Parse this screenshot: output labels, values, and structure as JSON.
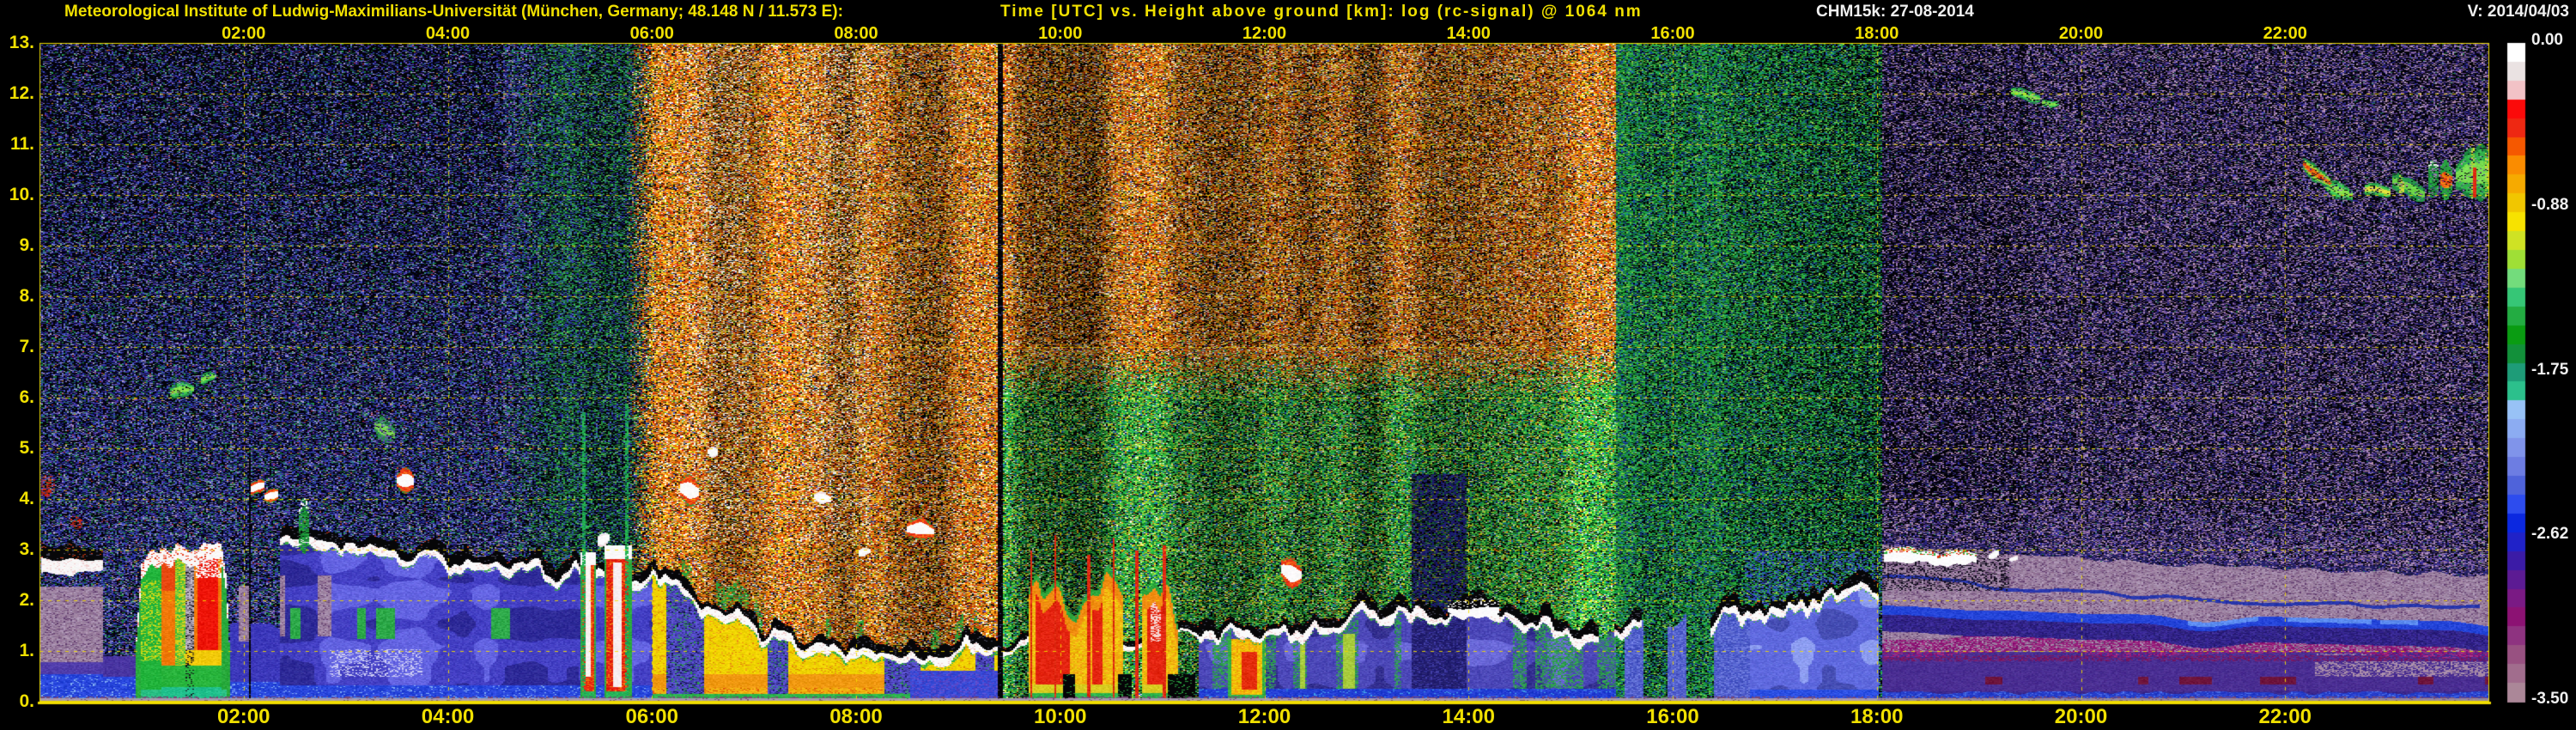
{
  "header": {
    "institute": "Meteorological Institute of Ludwig-Maximilians-Universität (München, Germany; 48.148 N / 11.573 E):",
    "plot_title": "Time [UTC] vs. Height above ground [km]: log (rc-signal) @ 1064 nm",
    "instrument_date": "CHM15k: 27-08-2014",
    "version": "V: 2014/04/03"
  },
  "chart_data": {
    "type": "heatmap",
    "title": "Time [UTC] vs. Height above ground [km]: log (rc-signal) @ 1064 nm",
    "xlabel": "Time [UTC]",
    "ylabel": "Height above ground [km]",
    "quantity": "log (rc-signal) @ 1064 nm",
    "instrument": "CHM15k",
    "date": "27-08-2014",
    "x_range_hours": [
      0,
      24
    ],
    "y_range_km": [
      0,
      13
    ],
    "grid": true,
    "time_ticks": [
      [
        "02:00",
        2
      ],
      [
        "04:00",
        4
      ],
      [
        "06:00",
        6
      ],
      [
        "08:00",
        8
      ],
      [
        "10:00",
        10
      ],
      [
        "12:00",
        12
      ],
      [
        "14:00",
        14
      ],
      [
        "16:00",
        16
      ],
      [
        "18:00",
        18
      ],
      [
        "20:00",
        20
      ],
      [
        "22:00",
        22
      ]
    ],
    "height_ticks": [
      [
        "0.",
        0
      ],
      [
        "1.",
        1
      ],
      [
        "2.",
        2
      ],
      [
        "3.",
        3
      ],
      [
        "4.",
        4
      ],
      [
        "5.",
        5
      ],
      [
        "6.",
        6
      ],
      [
        "7.",
        7
      ],
      [
        "8.",
        8
      ],
      [
        "9.",
        9
      ],
      [
        "10.",
        10
      ],
      [
        "11.",
        11
      ],
      [
        "12.",
        12
      ],
      [
        "13.",
        13
      ]
    ],
    "colorbar": {
      "labels": [
        [
          "0.00",
          0
        ],
        [
          "-0.88",
          -0.875
        ],
        [
          "-1.75",
          -1.75
        ],
        [
          "-2.62",
          -2.625
        ],
        [
          "-3.50",
          -3.5
        ]
      ],
      "colors": [
        "#ffffff",
        "#eae2e2",
        "#f2c2c6",
        "#fb0a0a",
        "#ee2812",
        "#f55800",
        "#fa8c00",
        "#f6aa00",
        "#f1c600",
        "#f7e200",
        "#cfe224",
        "#9fdf36",
        "#73dc7c",
        "#36c676",
        "#23ac42",
        "#0a9c12",
        "#12903a",
        "#1e9c78",
        "#2cc08c",
        "#98c2f6",
        "#8cacf2",
        "#8094ea",
        "#6d7de2",
        "#4f63da",
        "#2d4cee",
        "#0b28e0",
        "#2022c8",
        "#3b1ba6",
        "#5c1b93",
        "#7a1a84",
        "#8c1273",
        "#8e3380",
        "#985181",
        "#a16d8d",
        "#ab8798"
      ]
    },
    "colors": {
      "accent_yellow": "#f0e000",
      "grid_yellow": "#f0d800",
      "text_white": "#f0f0f0",
      "background": "#000000"
    },
    "scene": {
      "cloud_line": [
        [
          2.35,
          3.08
        ],
        [
          2.7,
          3.02
        ],
        [
          3.1,
          2.98
        ],
        [
          3.5,
          2.87
        ],
        [
          4.0,
          2.78
        ],
        [
          4.5,
          2.66
        ],
        [
          5.0,
          2.61
        ],
        [
          5.5,
          2.56
        ],
        [
          6.0,
          2.5
        ],
        [
          6.4,
          2.2
        ],
        [
          6.8,
          1.78
        ],
        [
          7.2,
          1.38
        ],
        [
          7.6,
          1.12
        ],
        [
          8.0,
          1.0
        ],
        [
          8.4,
          0.95
        ],
        [
          8.8,
          1.0
        ],
        [
          9.2,
          1.08
        ],
        [
          9.6,
          1.15
        ],
        [
          10.0,
          1.2
        ],
        [
          10.6,
          1.28
        ],
        [
          11.2,
          1.32
        ],
        [
          11.7,
          1.4
        ],
        [
          12.2,
          1.58
        ],
        [
          12.7,
          1.72
        ],
        [
          13.2,
          1.88
        ],
        [
          13.7,
          1.82
        ],
        [
          14.1,
          1.75
        ],
        [
          14.5,
          1.52
        ],
        [
          15.0,
          1.38
        ],
        [
          15.6,
          1.42
        ],
        [
          16.1,
          1.55
        ],
        [
          16.6,
          1.78
        ],
        [
          17.0,
          2.0
        ],
        [
          17.5,
          2.12
        ],
        [
          18.0,
          2.06
        ]
      ],
      "cloud_line_broken": [
        15.28,
        16.72
      ],
      "plume": {
        "range": [
          9.42,
          11.32
        ],
        "top_keys": [
          [
            9.42,
            0.7
          ],
          [
            9.52,
            1.6
          ],
          [
            9.62,
            2.2
          ],
          [
            9.72,
            2.45
          ],
          [
            9.82,
            2.15
          ],
          [
            9.95,
            2.5
          ],
          [
            10.05,
            2.0
          ],
          [
            10.15,
            1.75
          ],
          [
            10.3,
            2.25
          ],
          [
            10.45,
            2.5
          ],
          [
            10.55,
            2.35
          ],
          [
            10.65,
            2.0
          ],
          [
            10.78,
            2.3
          ],
          [
            10.9,
            2.1
          ],
          [
            11.0,
            2.5
          ],
          [
            11.1,
            1.95
          ],
          [
            11.2,
            1.3
          ],
          [
            11.32,
            0.85
          ]
        ],
        "black_gaps": [
          [
            10.02,
            10.14
          ],
          [
            10.57,
            10.7
          ],
          [
            11.06,
            11.32
          ]
        ],
        "red_spikes": [
          [
            9.72,
            3.0
          ],
          [
            9.95,
            3.3
          ],
          [
            10.28,
            2.9
          ],
          [
            10.52,
            3.25
          ],
          [
            10.75,
            3.0
          ],
          [
            11.02,
            3.1
          ]
        ]
      },
      "rain_a": {
        "range": [
          0.95,
          1.86
        ],
        "top_keys": [
          [
            0.95,
            1.3
          ],
          [
            1.0,
            2.8
          ],
          [
            1.1,
            3.0
          ],
          [
            1.22,
            2.9
          ],
          [
            1.35,
            3.08
          ],
          [
            1.48,
            2.95
          ],
          [
            1.58,
            3.18
          ],
          [
            1.68,
            3.05
          ],
          [
            1.78,
            3.0
          ],
          [
            1.83,
            2.4
          ],
          [
            1.86,
            1.1
          ]
        ],
        "segments": {
          "green1": 1.2,
          "red1": 1.33,
          "mid": 1.43,
          "gap": 1.51,
          "red2": 1.79
        }
      },
      "rain_b": {
        "shaft1": [
          5.3,
          5.45
        ],
        "shaft2": [
          5.53,
          5.8
        ],
        "top1": 2.95,
        "top2": 3.1
      },
      "night_layers": {
        "mauve_top": [
          [
            18.05,
            3.12
          ],
          [
            18.6,
            3.0
          ],
          [
            19.2,
            2.95
          ],
          [
            20.0,
            2.85
          ],
          [
            21.0,
            2.7
          ],
          [
            22.0,
            2.62
          ],
          [
            23.0,
            2.55
          ],
          [
            24.0,
            2.5
          ]
        ],
        "blue_line": [
          [
            18.2,
            2.5
          ],
          [
            19.0,
            2.3
          ],
          [
            20.0,
            2.15
          ],
          [
            21.0,
            2.05
          ],
          [
            22.0,
            1.95
          ],
          [
            23.0,
            1.92
          ],
          [
            24.0,
            1.9
          ]
        ],
        "blue_band": [
          [
            18.3,
            1.75
          ],
          [
            19.5,
            1.6
          ],
          [
            20.5,
            1.55
          ],
          [
            21.3,
            1.52
          ],
          [
            22.0,
            1.5
          ],
          [
            23.0,
            1.48
          ],
          [
            24.0,
            1.45
          ]
        ]
      },
      "gaps": [
        [
          2.055,
          0.01,
          4.9
        ],
        [
          9.415,
          0.022,
          13.2
        ]
      ],
      "green_vlines": [
        [
          5.335,
          5.72
        ],
        [
          5.755,
          5.88
        ]
      ],
      "blobs": [
        [
          0.02,
          0.62,
          2.84,
          2.8,
          0.62,
          "cloudjag"
        ],
        [
          0.02,
          0.15,
          4.2,
          4.25,
          0.55,
          "redspecks"
        ],
        [
          0.3,
          0.42,
          3.52,
          3.55,
          0.28,
          "redspecks"
        ],
        [
          1.28,
          1.52,
          6.12,
          6.22,
          0.3,
          "wisp"
        ],
        [
          1.58,
          1.73,
          6.36,
          6.4,
          0.22,
          "wisp"
        ],
        [
          2.07,
          2.2,
          4.17,
          4.26,
          0.36,
          "whitered"
        ],
        [
          2.21,
          2.34,
          4.06,
          4.1,
          0.3,
          "whitered"
        ],
        [
          2.54,
          2.64,
          3.45,
          3.45,
          1.15,
          "spire"
        ],
        [
          3.28,
          3.48,
          5.45,
          5.28,
          0.42,
          "wisppurple"
        ],
        [
          3.5,
          3.66,
          4.42,
          4.34,
          0.5,
          "whitered"
        ],
        [
          5.47,
          5.58,
          3.22,
          3.24,
          0.26,
          "white"
        ],
        [
          6.27,
          6.46,
          4.22,
          4.12,
          0.52,
          "whitered"
        ],
        [
          6.55,
          6.64,
          4.92,
          4.94,
          0.18,
          "white"
        ],
        [
          7.58,
          7.76,
          4.02,
          3.96,
          0.22,
          "white"
        ],
        [
          8.02,
          8.14,
          2.98,
          3.0,
          0.2,
          "white"
        ],
        [
          8.5,
          8.76,
          3.44,
          3.38,
          0.42,
          "whitered"
        ],
        [
          12.16,
          12.36,
          2.62,
          2.52,
          0.68,
          "whitered"
        ],
        [
          13.8,
          14.3,
          1.82,
          1.86,
          0.38,
          "whitearc"
        ],
        [
          18.07,
          18.98,
          2.88,
          2.82,
          0.28,
          "whiteline"
        ],
        [
          19.1,
          19.2,
          2.9,
          2.92,
          0.15,
          "white"
        ],
        [
          19.3,
          19.39,
          2.82,
          2.84,
          0.13,
          "white"
        ],
        [
          19.32,
          19.6,
          12.03,
          11.94,
          0.22,
          "wisp"
        ],
        [
          19.62,
          19.79,
          11.86,
          11.8,
          0.17,
          "wisp"
        ],
        [
          22.17,
          22.46,
          10.62,
          10.22,
          0.3,
          "cirrushot"
        ],
        [
          22.4,
          22.67,
          10.18,
          10.0,
          0.34,
          "wisp"
        ],
        [
          22.78,
          23.04,
          10.12,
          10.04,
          0.3,
          "cirrusyellow"
        ],
        [
          23.05,
          23.37,
          10.32,
          10.04,
          0.44,
          "wispstrokes"
        ],
        [
          23.4,
          23.51,
          10.32,
          10.3,
          0.78,
          "spire"
        ],
        [
          23.52,
          23.64,
          10.28,
          10.25,
          0.82,
          "spirehot"
        ],
        [
          23.68,
          24.02,
          10.38,
          10.46,
          1.2,
          "bigcirrus"
        ]
      ],
      "modulations": {
        "white_boost": [
          [
            6.35,
            6.95
          ],
          [
            7.45,
            8.15
          ]
        ],
        "teal_cols": [
          [
            15.5,
            15.78
          ],
          [
            16.18,
            16.48
          ]
        ],
        "navy_col": [
          13.45,
          13.98
        ],
        "blue_patch": [
          8.53,
          9.39,
          0.62
        ],
        "orange_col": [
          11.64,
          12.02,
          11.78,
          11.93
        ],
        "yellow_green_cols": [
          12.35,
          13.3
        ],
        "fleck_zone": [
          2.85,
          3.75
        ],
        "green_patch_zones": [
          [
            2.45,
            3.5
          ],
          [
            4.25,
            4.85
          ]
        ]
      },
      "palettes": {
        "night1": {
          "bg": "#030309",
          "colors": [
            [
              "#2830a0",
              3
            ],
            [
              "#4b5ac8",
              2
            ],
            [
              "#1a6434",
              1.2
            ],
            [
              "#22a452",
              0.7
            ],
            [
              "#8e86c2",
              1.1
            ],
            [
              "#5e2e96",
              1.0
            ],
            [
              "#0d0d46",
              2.0
            ],
            [
              "#b2aad2",
              0.55
            ],
            [
              "#c03020",
              0.12
            ],
            [
              "#cc8820",
              0.12
            ]
          ]
        },
        "dawn": {
          "bg": "#020406",
          "colors": [
            [
              "#1e8c3c",
              2.6
            ],
            [
              "#2838a0",
              1.8
            ],
            [
              "#145028",
              1.6
            ],
            [
              "#3cc05c",
              1.0
            ],
            [
              "#4858c8",
              0.9
            ],
            [
              "#0c0c3c",
              1.4
            ],
            [
              "#90b060",
              0.4
            ]
          ]
        },
        "brown": {
          "bg": "#000000",
          "colors": [
            [
              "#c85a08",
              3
            ],
            [
              "#8c3c08",
              2.2
            ],
            [
              "#e88c14",
              2.2
            ],
            [
              "#f0ead8",
              1.7
            ],
            [
              "#b41408",
              1.2
            ],
            [
              "#c8a850",
              1.5
            ],
            [
              "#dcc814",
              1.1
            ],
            [
              "#4c8c1c",
              0.65
            ],
            [
              "#3c50c0",
              0.4
            ],
            [
              "#101010",
              1.5
            ]
          ]
        },
        "green": {
          "bg": "#000000",
          "colors": [
            [
              "#1ea034",
              3
            ],
            [
              "#46c84a",
              2
            ],
            [
              "#0c6420",
              2
            ],
            [
              "#a0d850",
              1.1
            ],
            [
              "#d0cc20",
              1.0
            ],
            [
              "#1e54b4",
              0.85
            ],
            [
              "#c86410",
              0.5
            ],
            [
              "#e8e8dc",
              0.5
            ],
            [
              "#14a078",
              0.7
            ],
            [
              "#0a0a0a",
              1.3
            ]
          ]
        },
        "eve": {
          "bg": "#010204",
          "colors": [
            [
              "#1e9c34",
              2.6
            ],
            [
              "#3cba4c",
              1.5
            ],
            [
              "#0c5c20",
              1.9
            ],
            [
              "#98cc4c",
              0.7
            ],
            [
              "#1e54b4",
              0.95
            ],
            [
              "#123068",
              1.2
            ],
            [
              "#14a078",
              0.7
            ]
          ]
        },
        "night2": {
          "bg": "#020207",
          "colors": [
            [
              "#9678aa",
              2.2
            ],
            [
              "#5c3c8c",
              2.0
            ],
            [
              "#32287c",
              1.6
            ],
            [
              "#2828a0",
              1.0
            ],
            [
              "#16142e",
              2.0
            ],
            [
              "#b49cc8",
              0.8
            ],
            [
              "#1e7846",
              0.25
            ],
            [
              "#c89ab4",
              0.6
            ]
          ]
        }
      }
    }
  }
}
